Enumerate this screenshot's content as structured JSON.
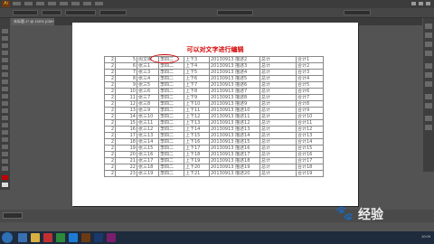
{
  "app": {
    "logo_text": "Ai",
    "tab_label": "未标题-1* @ 100% (CMYK/预览)"
  },
  "icons": {
    "app_logo": "illustrator-logo-icon",
    "paw": "baidu-paw-icon",
    "start": "windows-start-icon"
  },
  "document": {
    "title": "可以对文字进行编辑",
    "rows": [
      [
        "2",
        "5",
        "周文彬",
        "李四二",
        "上下3",
        "20130913 描述2",
        "总计",
        "合计1"
      ],
      [
        "2",
        "6",
        "张三1",
        "李四二",
        "上下4",
        "20130913 描述3",
        "总计",
        "合计2"
      ],
      [
        "2",
        "7",
        "张三3",
        "李四二",
        "上下5",
        "20130913 描述4",
        "总计",
        "合计3"
      ],
      [
        "2",
        "8",
        "张三4",
        "李四二",
        "上下6",
        "20130913 描述5",
        "总计",
        "合计4"
      ],
      [
        "2",
        "9",
        "张三5",
        "李四二",
        "上下7",
        "20130913 描述6",
        "总计",
        "合计5"
      ],
      [
        "2",
        "10",
        "张三6",
        "李四二",
        "上下8",
        "20130913 描述7",
        "总计",
        "合计6"
      ],
      [
        "2",
        "11",
        "张三7",
        "李四二",
        "上下9",
        "20130913 描述8",
        "总计",
        "合计7"
      ],
      [
        "2",
        "12",
        "张三8",
        "李四二",
        "上下10",
        "20130913 描述9",
        "总计",
        "合计8"
      ],
      [
        "2",
        "13",
        "张三9",
        "李四二",
        "上下11",
        "20130913 描述10",
        "总计",
        "合计9"
      ],
      [
        "2",
        "14",
        "张三10",
        "李四二",
        "上下12",
        "20130913 描述11",
        "总计",
        "合计10"
      ],
      [
        "2",
        "15",
        "张三11",
        "李四二",
        "上下13",
        "20130913 描述12",
        "总计",
        "合计11"
      ],
      [
        "2",
        "16",
        "张三12",
        "李四二",
        "上下14",
        "20130913 描述13",
        "总计",
        "合计12"
      ],
      [
        "2",
        "17",
        "张三13",
        "李四二",
        "上下15",
        "20130913 描述14",
        "总计",
        "合计13"
      ],
      [
        "2",
        "18",
        "张三14",
        "李四二",
        "上下16",
        "20130913 描述15",
        "总计",
        "合计14"
      ],
      [
        "2",
        "19",
        "张三15",
        "李四二",
        "上下17",
        "20130913 描述16",
        "总计",
        "合计15"
      ],
      [
        "2",
        "20",
        "张三16",
        "李四二",
        "上下18",
        "20130913 描述17",
        "总计",
        "合计16"
      ],
      [
        "2",
        "21",
        "张三17",
        "李四二",
        "上下19",
        "20130913 描述18",
        "总计",
        "合计17"
      ],
      [
        "2",
        "22",
        "张三18",
        "李四二",
        "上下20",
        "20130913 描述19",
        "总计",
        "合计18"
      ],
      [
        "2",
        "23",
        "张三19",
        "李四二",
        "上下21",
        "20130913 描述20",
        "总计",
        "合计19"
      ]
    ]
  },
  "watermark": {
    "text": "经验"
  },
  "taskbar": {
    "time": "10:09"
  },
  "colors": {
    "title": "#d40000",
    "selection_circle": "#d00000",
    "taskbar": "#1d2b3d"
  }
}
